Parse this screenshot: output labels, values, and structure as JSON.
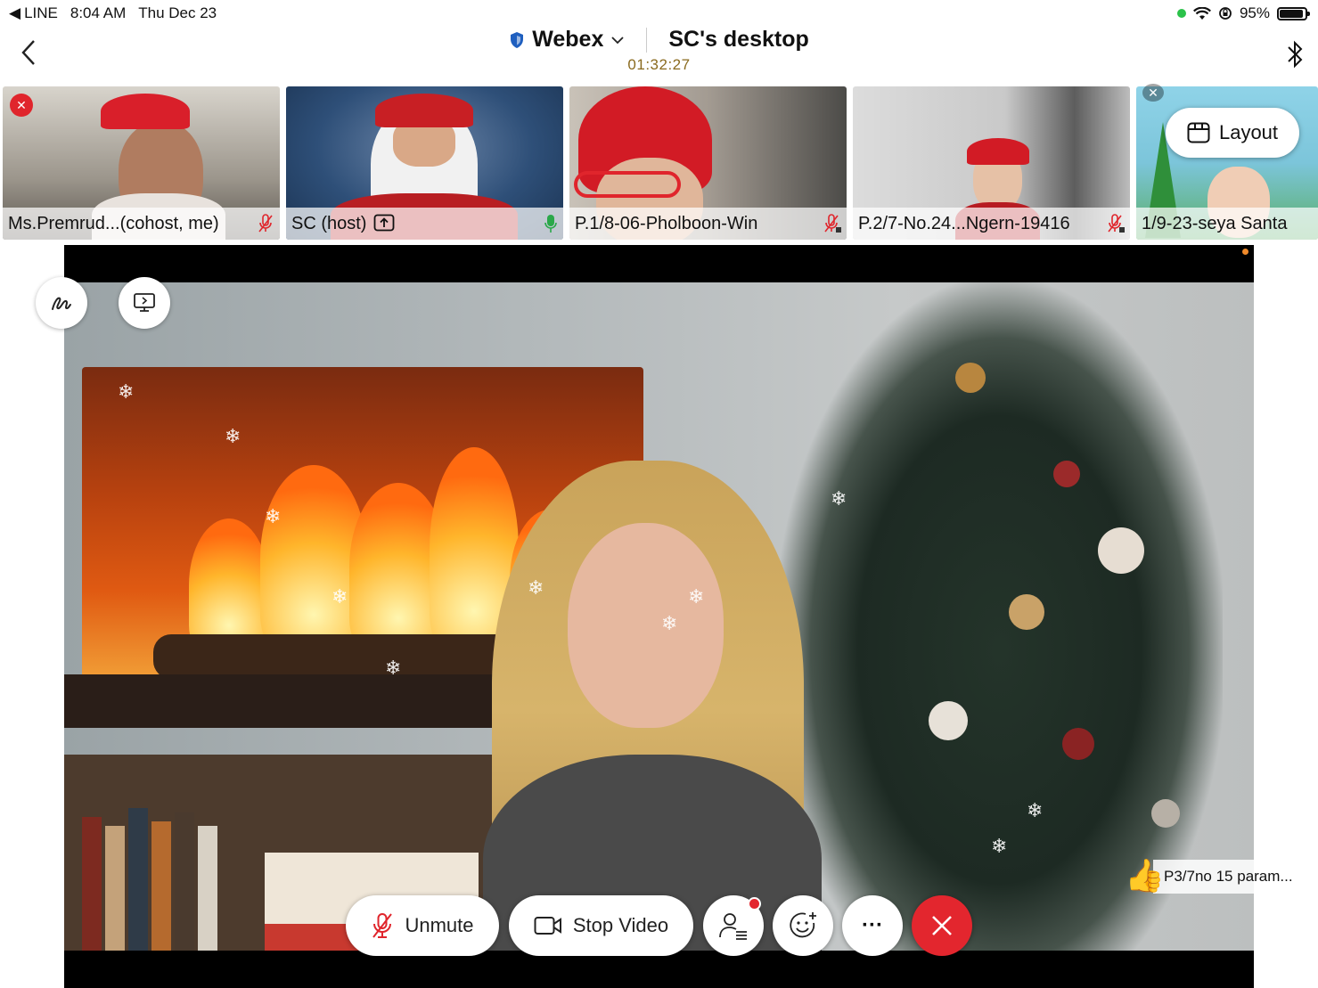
{
  "status_bar": {
    "back_app": "LINE",
    "time": "8:04 AM",
    "date": "Thu Dec 23",
    "battery": "95%"
  },
  "header": {
    "app_name": "Webex",
    "share_title": "SC's desktop",
    "timer": "01:32:27"
  },
  "participants": [
    {
      "name": "Ms.Premrud...(cohost, me)"
    },
    {
      "name": "SC (host)"
    },
    {
      "name": "P.1/8-06-Pholboon-Win"
    },
    {
      "name": "P.2/7-No.24...Ngern-19416"
    },
    {
      "name": "1/9-23-seya Santa"
    }
  ],
  "layout_button": {
    "label": "Layout"
  },
  "reaction": {
    "text": "P3/7no 15 param..."
  },
  "controls": {
    "unmute_label": "Unmute",
    "stop_video_label": "Stop Video",
    "more_label": "···"
  },
  "colors": {
    "end_call": "#e3262e",
    "mute_red": "#e0252c",
    "timer": "#8a6a1e",
    "shield_blue": "#1f5fbf",
    "unmuted_green": "#2aa84a"
  },
  "icons": {
    "annotate": "annotate-icon",
    "share_screen": "share-screen-icon",
    "participants": "participants-icon",
    "reactions": "reactions-icon",
    "end": "close-icon",
    "bluetooth": "bluetooth-icon"
  }
}
